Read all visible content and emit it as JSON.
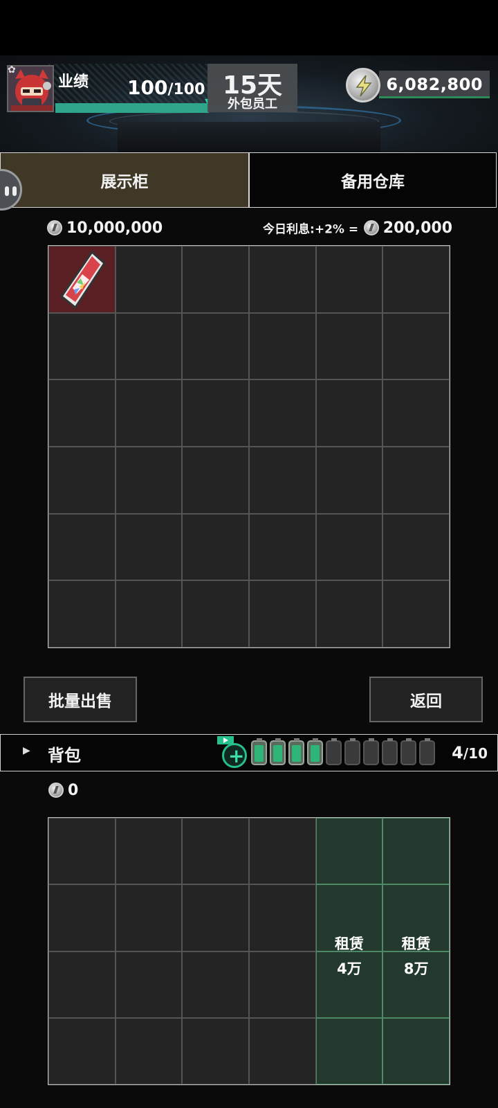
{
  "header": {
    "performance_label": "业绩",
    "performance_current": "100",
    "performance_max": "/100",
    "performance_fraction": 1.0,
    "days": "15天",
    "job_title": "外包员工",
    "money": "6,082,800"
  },
  "tabs": [
    {
      "label": "展示柜",
      "active": true
    },
    {
      "label": "备用仓库",
      "active": false
    }
  ],
  "showcase": {
    "value": "10,000,000",
    "interest_label": "今日利息:+2% =",
    "interest_amount": "200,000",
    "rows": 6,
    "cols": 6,
    "items": [
      {
        "row": 0,
        "col": 0,
        "name": "red-crystal-icon"
      }
    ]
  },
  "buttons": {
    "bulk_sell": "批量出售",
    "back": "返回"
  },
  "backpack": {
    "label": "背包",
    "count": "4",
    "max": "/10",
    "batteries_full": 4,
    "batteries_total": 10,
    "value": "0",
    "rows": 4,
    "cols": 6,
    "rent_slots": [
      {
        "col": 4,
        "label": "租赁",
        "price": "4万"
      },
      {
        "col": 5,
        "label": "租赁",
        "price": "8万"
      }
    ]
  },
  "colors": {
    "accent_green": "#26c08c",
    "active_tab": "#403826",
    "rent_cell": "#24392e",
    "item_cell": "#5a1f22"
  }
}
